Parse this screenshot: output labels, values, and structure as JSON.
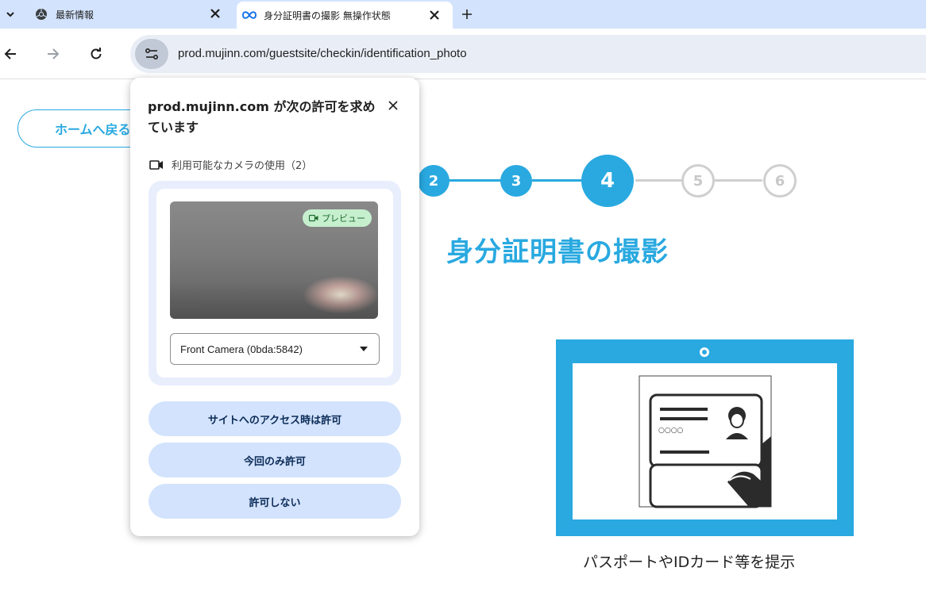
{
  "tabs": [
    {
      "title": "最新情報",
      "icon": "chrome-icon"
    },
    {
      "title": "身分証明書の撮影 無操作状態",
      "icon": "infinity-icon"
    }
  ],
  "toolbar": {
    "url": "prod.mujinn.com/guestsite/checkin/identification_photo"
  },
  "page": {
    "home_button": "ホームへ戻る",
    "steps": [
      "2",
      "3",
      "4",
      "5",
      "6"
    ],
    "current_step": "4",
    "title": "身分証明書の撮影",
    "card_text": "○○○○",
    "caption": "パスポートやIDカード等を提示"
  },
  "popup": {
    "title": "prod.mujinn.com が次の許可を求めています",
    "permission": "利用可能なカメラの使用（2）",
    "preview_badge": "プレビュー",
    "camera_select": "Front Camera (0bda:5842)",
    "allow_always": "サイトへのアクセス時は許可",
    "allow_once": "今回のみ許可",
    "deny": "許可しない"
  },
  "colors": {
    "accent": "#29a9e0",
    "tabstrip": "#d3e3fd",
    "button_bg": "#d3e3fd",
    "inactive_step": "#cfcfcf"
  }
}
